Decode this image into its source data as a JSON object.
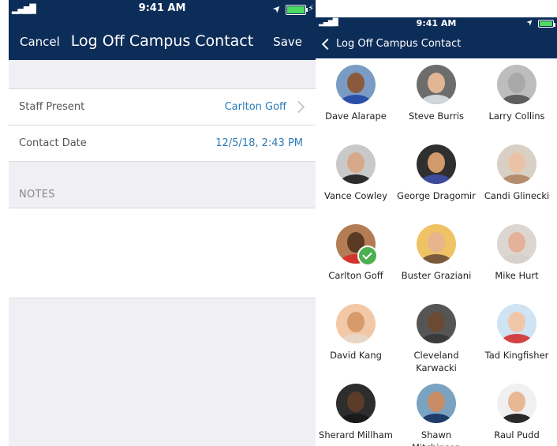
{
  "left": {
    "status": {
      "time": "9:41 AM",
      "signal": "▂▄▆█",
      "location": "➤",
      "charging": "⚡"
    },
    "nav": {
      "cancel": "Cancel",
      "title": "Log Off Campus Contact",
      "save": "Save"
    },
    "rows": [
      {
        "label": "Staff Present",
        "value": "Carlton Goff"
      },
      {
        "label": "Contact Date",
        "value": "12/5/18, 2:43 PM"
      }
    ],
    "notes_label": "NOTES"
  },
  "right": {
    "status": {
      "time": "9:41 AM",
      "signal": "▂▄▆█",
      "location": "➤"
    },
    "nav": {
      "back_label": "Log Off Campus Contact"
    },
    "people": [
      {
        "name": "Dave Alarape",
        "bg": "#7a9cc4",
        "skin": "#8b5a3c",
        "shirt": "#2b4fa8"
      },
      {
        "name": "Steve Burris",
        "bg": "#6d6d6d",
        "skin": "#e2b595",
        "shirt": "#cfd6dc"
      },
      {
        "name": "Larry Collins",
        "bg": "#bdbdbd",
        "skin": "#a8a8a8",
        "shirt": "#5e5e5e"
      },
      {
        "name": "Vance Cowley",
        "bg": "#c9c9c9",
        "skin": "#d7a98a",
        "shirt": "#2c2c2c"
      },
      {
        "name": "George Dragomir",
        "bg": "#2f2f2f",
        "skin": "#d19a6a",
        "shirt": "#3e4b9c"
      },
      {
        "name": "Candi Glinecki",
        "bg": "#d8d0c4",
        "skin": "#eac3a6",
        "shirt": "#b58c6e"
      },
      {
        "name": "Carlton Goff",
        "bg": "#b37c54",
        "skin": "#5a3a23",
        "shirt": "#d4332e",
        "selected": true
      },
      {
        "name": "Buster Graziani",
        "bg": "#f0c266",
        "skin": "#e7b48d",
        "shirt": "#7a5a3c"
      },
      {
        "name": "Mike Hurt",
        "bg": "#dcd6d0",
        "skin": "#e6b19a",
        "shirt": "#d7d1cb"
      },
      {
        "name": "David Kang",
        "bg": "#f2c8a6",
        "skin": "#d69a6b",
        "shirt": "#e8d6c6"
      },
      {
        "name": "Cleveland Karwacki",
        "bg": "#555555",
        "skin": "#6b4a33",
        "shirt": "#3a3a3a"
      },
      {
        "name": "Tad Kingfisher",
        "bg": "#cfe3f2",
        "skin": "#f0c6a8",
        "shirt": "#d44141"
      },
      {
        "name": "Sherard Millham",
        "bg": "#2d2d2d",
        "skin": "#5a3c28",
        "shirt": "#1a1a1a"
      },
      {
        "name": "Shawn Mitchinson",
        "bg": "#7aa3c2",
        "skin": "#c88c66",
        "shirt": "#1f3d6b"
      },
      {
        "name": "Raul Pudd",
        "bg": "#f0f0f0",
        "skin": "#e8b894",
        "shirt": "#2a2a2a"
      }
    ]
  },
  "colors": {
    "navy": "#0d2d59",
    "link": "#2a7ab8",
    "band": "#efeff4",
    "check": "#4caf50"
  }
}
